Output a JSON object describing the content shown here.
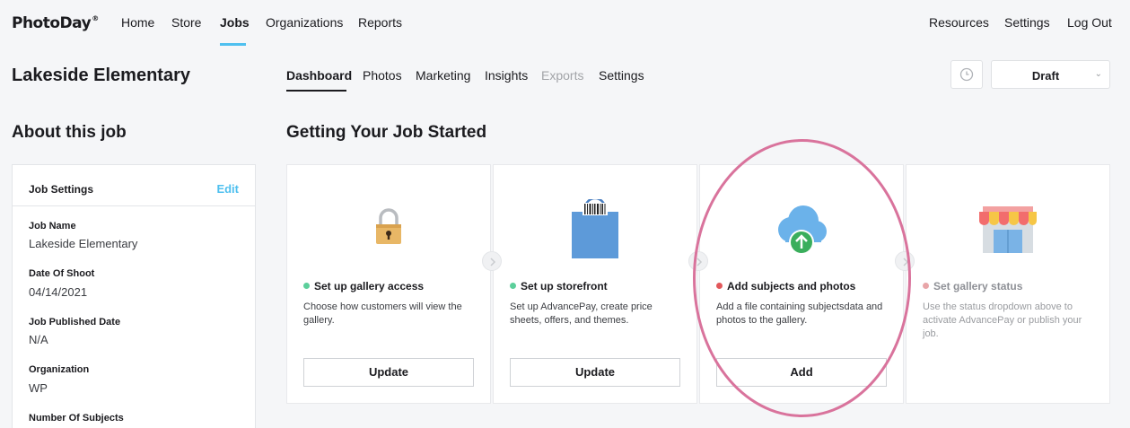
{
  "brand": {
    "logo": "PhotoDay",
    "trademark": "®"
  },
  "topnav": {
    "left": [
      {
        "label": "Home",
        "active": false
      },
      {
        "label": "Store",
        "active": false
      },
      {
        "label": "Jobs",
        "active": true
      },
      {
        "label": "Organizations",
        "active": false
      },
      {
        "label": "Reports",
        "active": false
      }
    ],
    "right": [
      {
        "label": "Resources"
      },
      {
        "label": "Settings"
      },
      {
        "label": "Log Out"
      }
    ]
  },
  "job": {
    "title": "Lakeside Elementary",
    "tabs": [
      {
        "label": "Dashboard",
        "state": "active"
      },
      {
        "label": "Photos",
        "state": "normal"
      },
      {
        "label": "Marketing",
        "state": "normal"
      },
      {
        "label": "Insights",
        "state": "normal"
      },
      {
        "label": "Exports",
        "state": "disabled"
      },
      {
        "label": "Settings",
        "state": "normal"
      }
    ],
    "history_icon": "clock-icon",
    "status": {
      "value": "Draft",
      "icon": "chevron-down-icon"
    }
  },
  "about": {
    "heading": "About this job",
    "panel_title": "Job Settings",
    "edit_label": "Edit",
    "fields": [
      {
        "label": "Job Name",
        "value": "Lakeside Elementary"
      },
      {
        "label": "Date Of Shoot",
        "value": "04/14/2021"
      },
      {
        "label": "Job Published Date",
        "value": "N/A"
      },
      {
        "label": "Organization",
        "value": "WP"
      },
      {
        "label": "Number Of Subjects",
        "value": ""
      }
    ]
  },
  "getting_started": {
    "heading": "Getting Your Job Started",
    "cards": [
      {
        "title": "Set up gallery access",
        "description": "Choose how customers will view the gallery.",
        "button": "Update",
        "status_color": "#5ccf9b",
        "icon": "lock-icon"
      },
      {
        "title": "Set up storefront",
        "description": "Set up AdvancePay, create price sheets, offers, and themes.",
        "button": "Update",
        "status_color": "#5ccf9b",
        "icon": "shopping-bag-icon"
      },
      {
        "title": "Add subjects and photos",
        "description": "Add a file containing subjectsdata and photos to the gallery.",
        "button": "Add",
        "status_color": "#e2585b",
        "icon": "cloud-upload-icon"
      },
      {
        "title": "Set gallery status",
        "description": "Use the status dropdown above to activate AdvancePay or publish your job.",
        "button": "",
        "status_color": "#e8a5a8",
        "icon": "storefront-icon"
      }
    ]
  },
  "colors": {
    "accent": "#4fc0ef",
    "highlight_ring": "#d9739c"
  }
}
